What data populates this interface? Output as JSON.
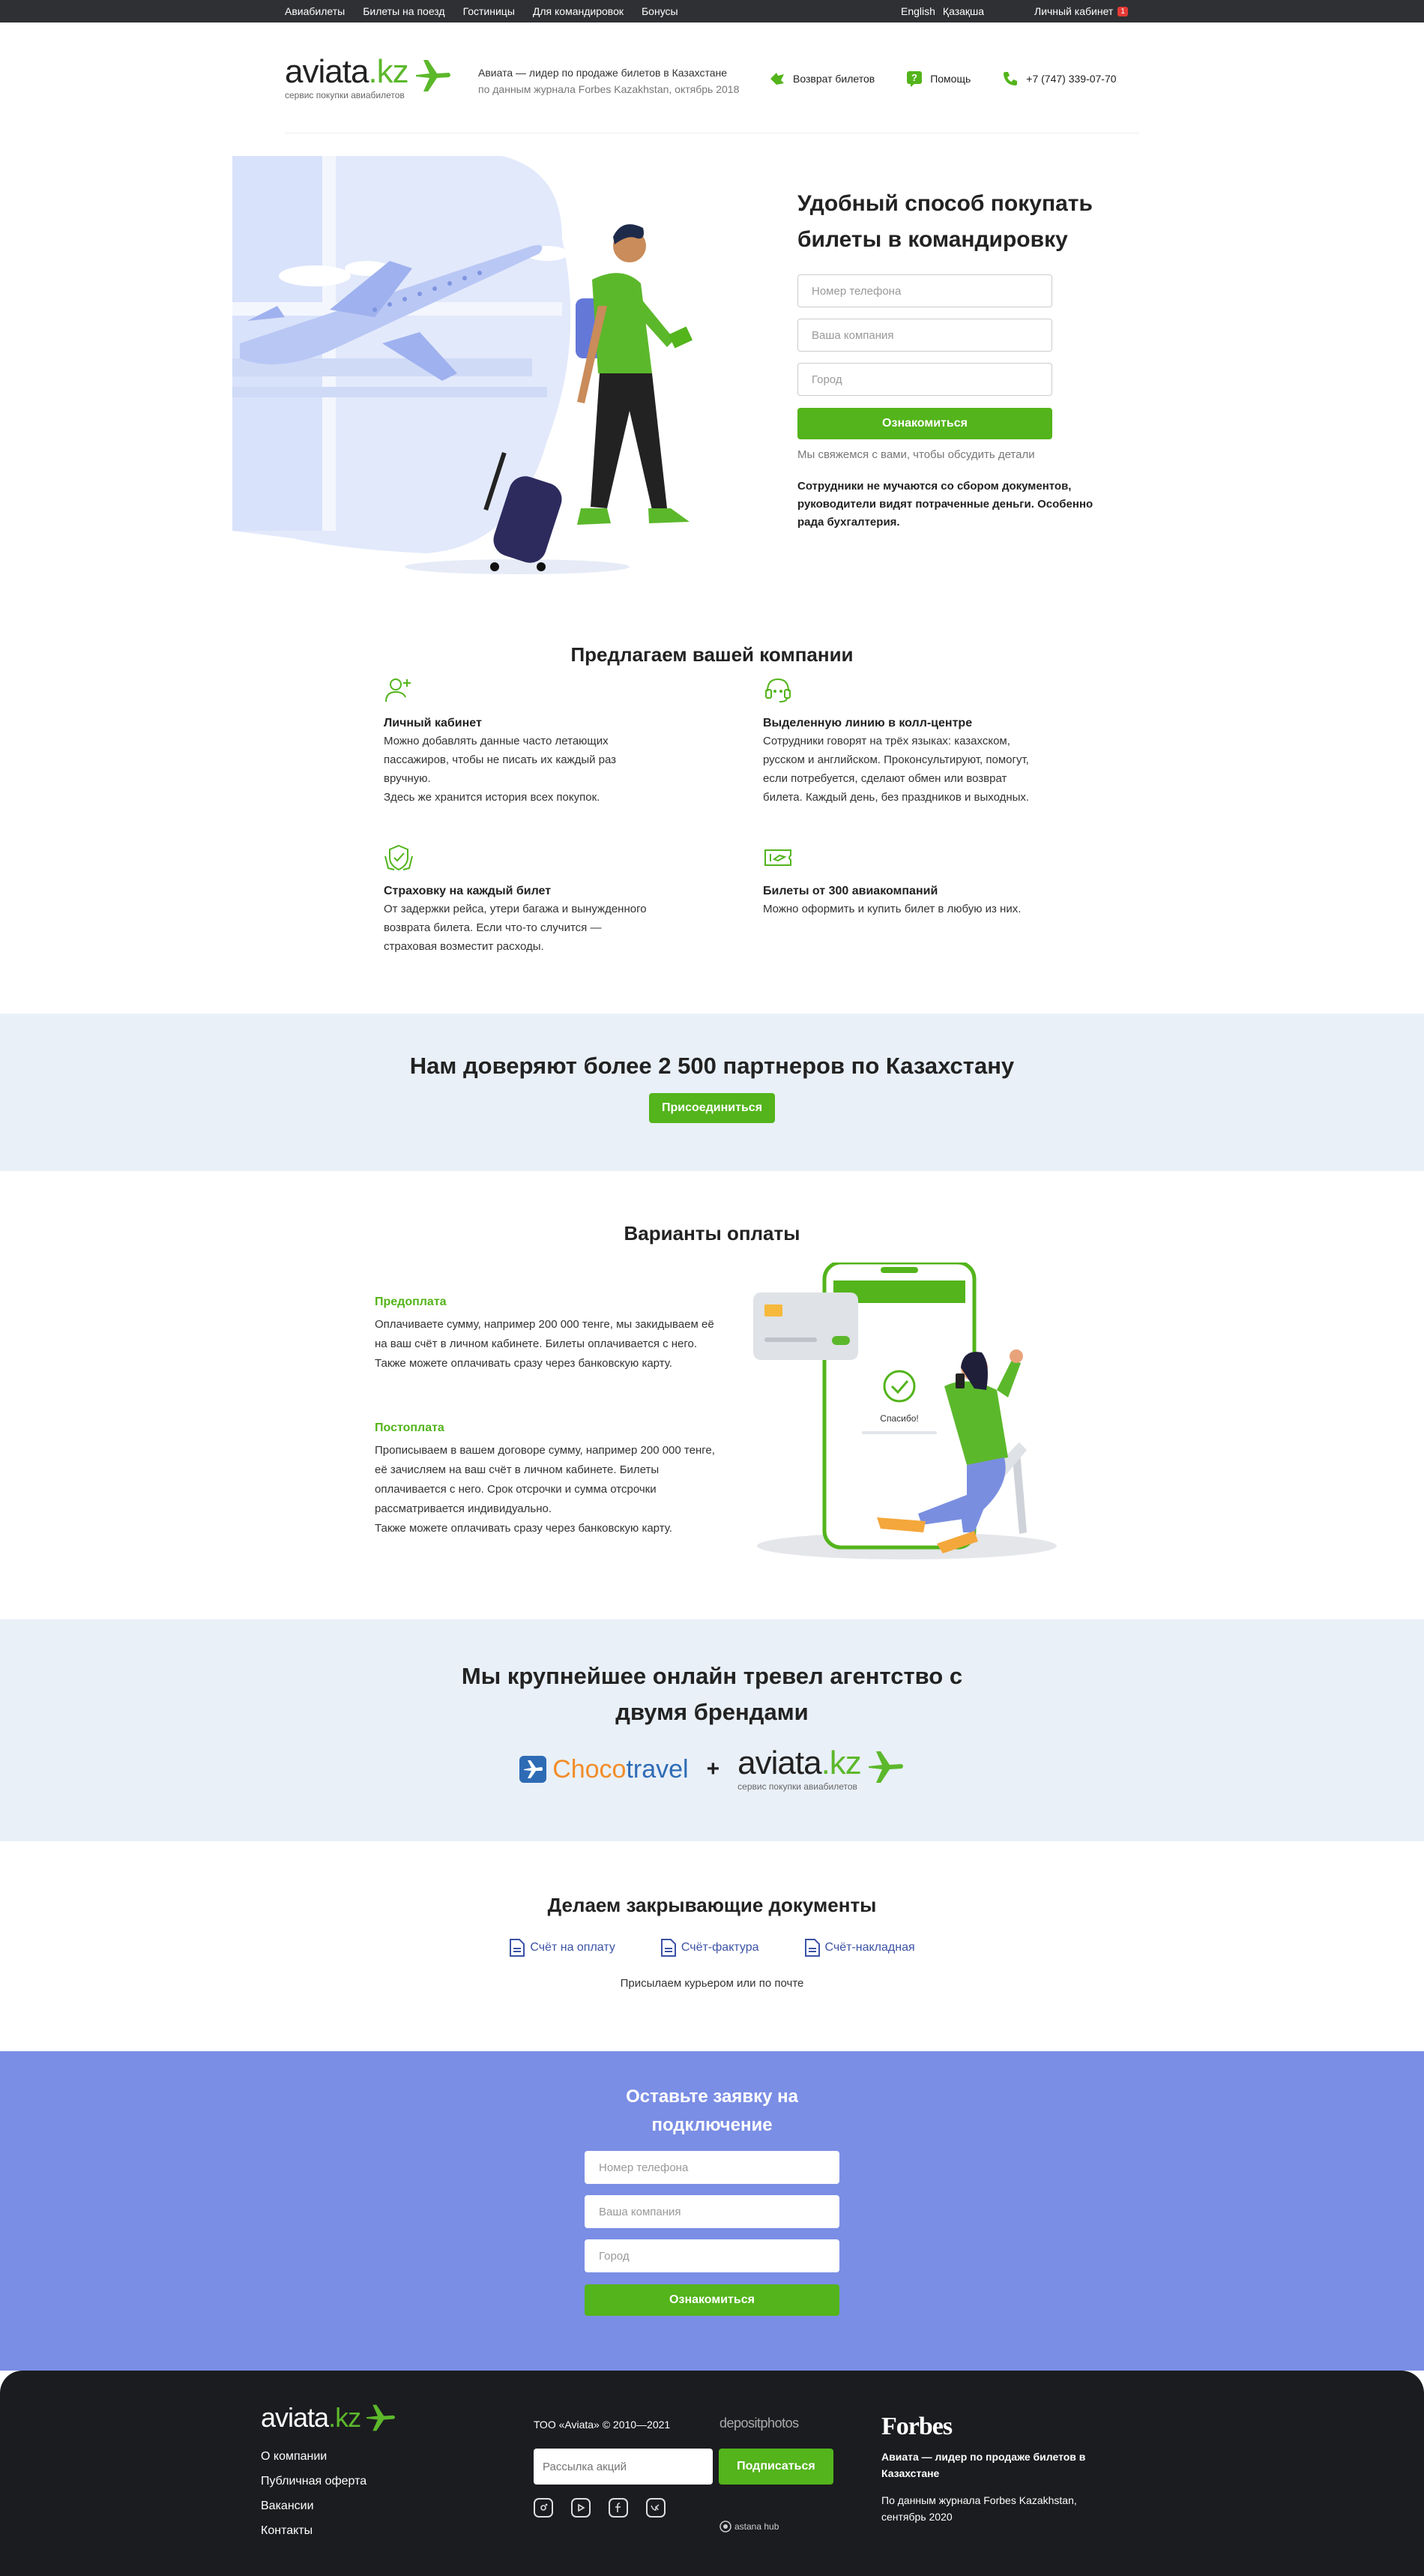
{
  "topbar": {
    "nav": [
      "Авиабилеты",
      "Билеты на поезд",
      "Гостиницы",
      "Для командировок",
      "Бонусы"
    ],
    "lang_en": "English",
    "lang_kz": "Қазақша",
    "account": "Личный кабинет",
    "badge": "1"
  },
  "header": {
    "logo_word": "aviata",
    "logo_kz": ".kz",
    "logo_sub": "сервис покупки авиабилетов",
    "claim_line1": "Авиата — лидер по продаже билетов в Казахстане",
    "claim_line2": "по данным журнала Forbes Kazakhstan, октябрь 2018",
    "refund": "Возврат билетов",
    "help": "Помощь",
    "phone": "+7 (747) 339-07-70"
  },
  "hero": {
    "title": "Удобный способ покупать билеты в командировку",
    "phone_placeholder": "Номер телефона",
    "company_placeholder": "Ваша компания",
    "city_placeholder": "Город",
    "submit": "Ознакомиться",
    "note": "Мы свяжемся с вами, чтобы обсудить детали",
    "desc": "Сотрудники не мучаются со сбором документов, руководители видят потраченные деньги. Особенно рада бухгалтерия."
  },
  "offers": {
    "title": "Предлагаем вашей компании",
    "items": [
      {
        "icon": "user-plus-icon",
        "title": "Личный кабинет",
        "text": "Можно добавлять данные часто летающих пассажиров, чтобы не писать их каждый раз вручную.",
        "text2": "Здесь же хранится история всех покупок."
      },
      {
        "icon": "headset-icon",
        "title": "Выделенную линию в колл-центре",
        "text": "Сотрудники говорят на трёх языках: казахском, русском и английском. Проконсультируют, помогут, если потребуется, сделают обмен или возврат билета. Каждый день, без праздников и выходных.",
        "text2": ""
      },
      {
        "icon": "shield-hand-icon",
        "title": "Страховку на каждый билет",
        "text": "От задержки рейса, утери багажа и вынужденного возврата билета. Если что-то случится — страховая возместит расходы.",
        "text2": ""
      },
      {
        "icon": "ticket-icon",
        "title": "Билеты от 300 авиакомпаний",
        "text": "Можно оформить и купить билет в любую из них.",
        "text2": ""
      }
    ]
  },
  "trust": {
    "title": "Нам доверяют более 2 500 партнеров по Казахстану",
    "button": "Присоединиться"
  },
  "payment": {
    "title": "Варианты оплаты",
    "prepay_title": "Предоплата",
    "prepay_text": "Оплачиваете сумму, например 200 000 тенге, мы закидываем её на ваш счёт в личном кабинете. Билеты оплачивается с него.",
    "prepay_text2": "Также можете оплачивать сразу через банковскую карту.",
    "postpay_title": "Постоплата",
    "postpay_text": "Прописываем в вашем договоре сумму, например 200 000 тенге, её зачисляем на ваш счёт в личном кабинете. Билеты оплачивается с него. Срок отсрочки и сумма отсрочки рассматривается индивидуально.",
    "postpay_text2": "Также можете оплачивать сразу через банковскую карту.",
    "phone_thanks": "Спасибо!"
  },
  "brands": {
    "title": "Мы крупнейшее онлайн тревел агентство с двумя брендами",
    "choco_a": "Choco",
    "choco_b": "travel",
    "plus": "+",
    "aviata_word": "aviata",
    "aviata_kz": ".kz",
    "aviata_sub": "сервис покупки авиабилетов"
  },
  "docs": {
    "title": "Делаем закрывающие документы",
    "links": [
      "Счёт на оплату",
      "Счёт-фактура",
      "Счёт-накладная"
    ],
    "sub": "Присылаем курьером или по почте"
  },
  "request": {
    "title_line1": "Оставьте заявку на",
    "title_line2": "подключение",
    "phone_placeholder": "Номер телефона",
    "company_placeholder": "Ваша компания",
    "city_placeholder": "Город",
    "submit": "Ознакомиться"
  },
  "footer": {
    "logo_word": "aviata",
    "logo_kz": ".kz",
    "menu": [
      "О компании",
      "Публичная оферта",
      "Вакансии",
      "Контакты"
    ],
    "copyright": "ТОО «Aviata» © 2010—2021",
    "depositphotos": "depositphotos",
    "subscribe_placeholder": "Рассылка акций",
    "subscribe_button": "Подписаться",
    "astana_hub": "astana hub",
    "forbes": "Forbes",
    "lead": "Авиата — лидер по продаже билетов в Казахстане",
    "source": "По данным журнала Forbes Kazakhstan, сентябрь 2020"
  },
  "colors": {
    "green": "#53b41b",
    "dark": "#2f3033",
    "light_section": "#e9f0f8",
    "request_bg": "#7b8ee5",
    "footer_bg": "#1b1c1f",
    "link_blue": "#3b52a5"
  }
}
